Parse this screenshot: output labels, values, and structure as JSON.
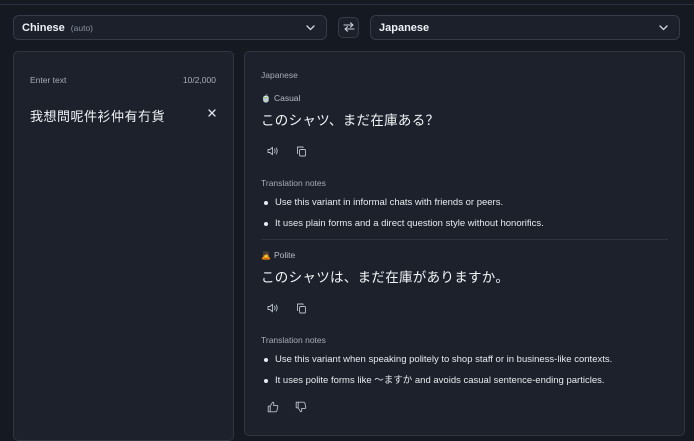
{
  "source_lang": {
    "name": "Chinese",
    "sub": "(auto)"
  },
  "target_lang": {
    "name": "Japanese"
  },
  "input": {
    "label": "Enter text",
    "counter": "10/2,000",
    "text": "我想問呢件衫仲有冇貨"
  },
  "output": {
    "label": "Japanese",
    "variants": [
      {
        "emoji": "🍵",
        "tag": "Casual",
        "text": "このシャツ、まだ在庫ある？",
        "notes_title": "Translation notes",
        "notes": [
          "Use this variant in informal chats with friends or peers.",
          "It uses plain forms and a direct question style without honorifics."
        ]
      },
      {
        "emoji": "🙇",
        "tag": "Polite",
        "text": "このシャツは、まだ在庫がありますか。",
        "notes_title": "Translation notes",
        "notes": [
          "Use this variant when speaking politely to shop staff or in business-like contexts.",
          "It uses polite forms like 〜ますか and avoids casual sentence-ending particles."
        ]
      }
    ]
  },
  "icons": {
    "chevron": "chevron-down-icon",
    "swap": "swap-icon",
    "clear": "close-icon",
    "speak": "speaker-icon",
    "copy": "copy-icon",
    "like": "thumbs-up-icon",
    "dislike": "thumbs-down-icon"
  }
}
